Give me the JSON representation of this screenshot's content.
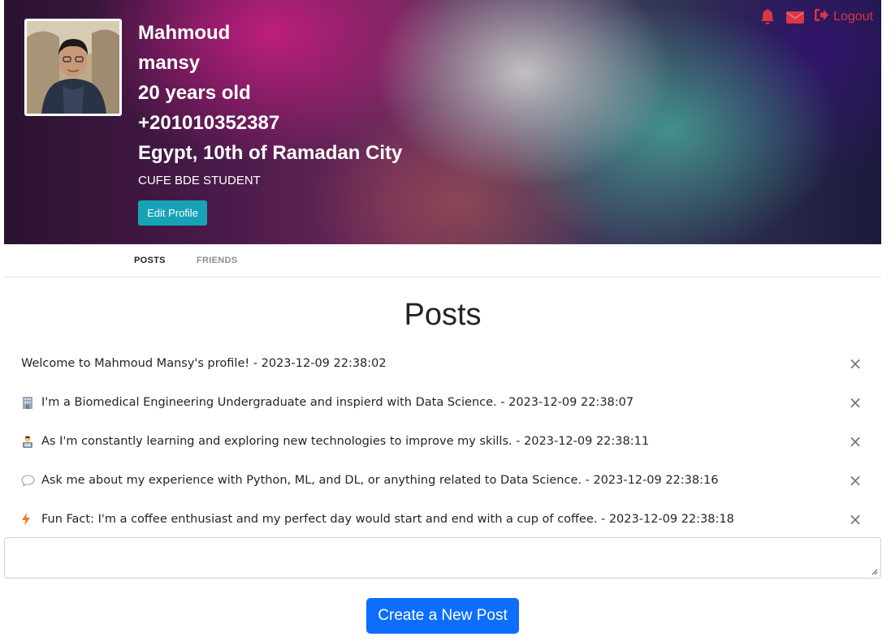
{
  "profile": {
    "first_name": "Mahmoud",
    "last_name": "mansy",
    "age": "20 years old",
    "phone": "+201010352387",
    "location": "Egypt, 10th of Ramadan City",
    "bio": "CUFE BDE STUDENT",
    "edit_label": "Edit Profile"
  },
  "top_actions": {
    "notification_icon": "bell-icon",
    "message_icon": "envelope-icon",
    "logout_icon": "sign-out-icon",
    "logout_label": "Logout",
    "color": "#dc3545"
  },
  "tabs": [
    {
      "label": "POSTS",
      "active": true
    },
    {
      "label": "FRIENDS",
      "active": false
    }
  ],
  "posts_title": "Posts",
  "posts": [
    {
      "emoji": "",
      "text": "Welcome to Mahmoud Mansy's profile! - 2023-12-09 22:38:02"
    },
    {
      "emoji": "office-building-icon",
      "text": "I'm a Biomedical Engineering Undergraduate and inspierd with Data Science. - 2023-12-09 22:38:07"
    },
    {
      "emoji": "technologist-icon",
      "text": "As I'm constantly learning and exploring new technologies to improve my skills. - 2023-12-09 22:38:11"
    },
    {
      "emoji": "speech-bubble-icon",
      "text": "Ask me about my experience with Python, ML, and DL, or anything related to Data Science. - 2023-12-09 22:38:16"
    },
    {
      "emoji": "lightning-icon",
      "text": "Fun Fact: I'm a coffee enthusiast and my perfect day would start and end with a cup of coffee. - 2023-12-09 22:38:18"
    }
  ],
  "delete_symbol": "×",
  "new_post": {
    "value": "",
    "button_label": "Create a New Post",
    "button_color": "#0d6efd"
  },
  "colors": {
    "edit_button": "#17a2b8"
  }
}
